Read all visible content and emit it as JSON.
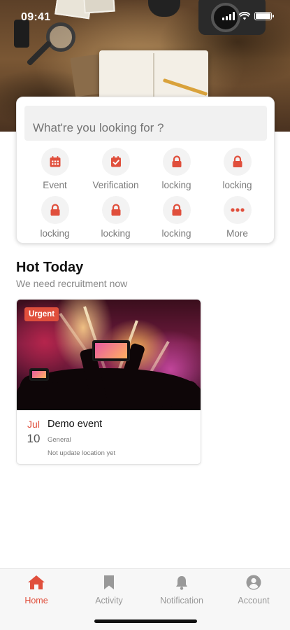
{
  "status_bar": {
    "time": "09:41"
  },
  "search": {
    "placeholder": "What're you looking for ?"
  },
  "categories": [
    {
      "label": "Event",
      "icon": "calendar-icon",
      "locked": false
    },
    {
      "label": "Verification",
      "icon": "check-calendar-icon",
      "locked": false
    },
    {
      "label": "locking",
      "icon": "lock-icon",
      "locked": true
    },
    {
      "label": "locking",
      "icon": "lock-icon",
      "locked": true
    },
    {
      "label": "locking",
      "icon": "lock-icon",
      "locked": true
    },
    {
      "label": "locking",
      "icon": "lock-icon",
      "locked": true
    },
    {
      "label": "locking",
      "icon": "lock-icon",
      "locked": true
    },
    {
      "label": "More",
      "icon": "more-dots-icon",
      "locked": false
    }
  ],
  "section": {
    "title": "Hot Today",
    "subtitle": "We need recruitment now"
  },
  "event": {
    "badge": "Urgent",
    "month": "Jul",
    "day": "10",
    "title": "Demo event",
    "category": "General",
    "location": "Not update location yet"
  },
  "tabs": [
    {
      "label": "Home",
      "icon": "home-icon",
      "active": true
    },
    {
      "label": "Activity",
      "icon": "bookmark-icon",
      "active": false
    },
    {
      "label": "Notification",
      "icon": "bell-icon",
      "active": false
    },
    {
      "label": "Account",
      "icon": "account-icon",
      "active": false
    }
  ],
  "colors": {
    "accent": "#e04f3c",
    "inactive": "#999999",
    "background": "#ffffff"
  }
}
